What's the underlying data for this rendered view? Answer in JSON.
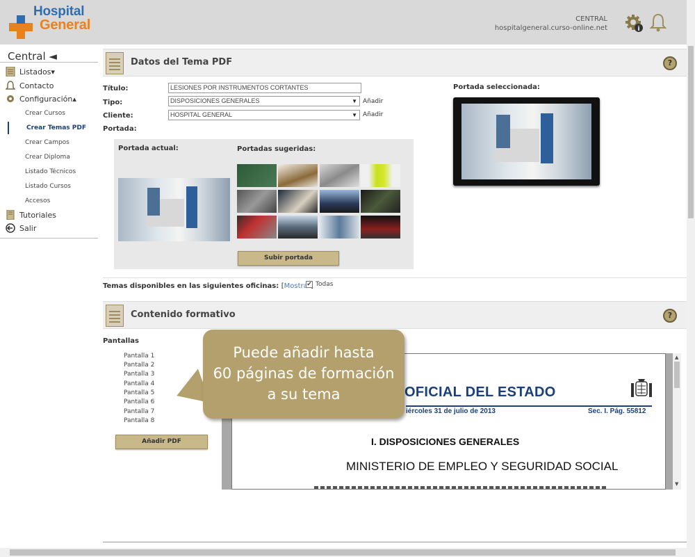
{
  "header": {
    "logo_line1": "Hospital",
    "logo_line2": "General",
    "account_name": "CENTRAL",
    "account_domain": "hospitalgeneral.curso-online.net",
    "settings_icon": "gear-info-icon",
    "notifications_icon": "bell-icon"
  },
  "sidebar": {
    "title": "Central ◄",
    "items": [
      {
        "label": "Listados▾",
        "icon": "list-icon"
      },
      {
        "label": "Contacto",
        "icon": "bell-icon"
      },
      {
        "label": "Configuración▴",
        "icon": "gear-icon"
      },
      {
        "label": "Tutoriales",
        "icon": "book-icon"
      },
      {
        "label": "Salir",
        "icon": "exit-icon"
      }
    ],
    "subitems": [
      "Crear Cursos",
      "Crear Temas PDF",
      "Crear Campos",
      "Crear Diploma",
      "Listado Técnicos",
      "Listado Cursos",
      "Accesos"
    ],
    "active_subitem": "Crear Temas PDF"
  },
  "section1": {
    "title": "Datos del Tema PDF",
    "help": "?",
    "titulo_label": "Título:",
    "titulo_value": "LESIONES POR INSTRUMENTOS CORTANTES",
    "tipo_label": "Tipo:",
    "tipo_value": "DISPOSICIONES GENERALES",
    "cliente_label": "Cliente:",
    "cliente_value": "HOSPITAL GENERAL",
    "add_label": "Añadir",
    "portada_label": "Portada:",
    "portada_actual": "Portada actual:",
    "portadas_sugeridas": "Portadas sugeridas:",
    "upload_button": "Subir portada",
    "portada_seleccionada": "Portada seleccionada:"
  },
  "offices": {
    "label": "Temas disponibles en las siguientes oficinas:",
    "show_link": "Mostrar",
    "bracket_open": "[",
    "bracket_close": "]",
    "all_label": "Todas",
    "all_checked": true
  },
  "section2": {
    "title": "Contenido formativo",
    "help": "?",
    "pantallas_label": "Pantallas",
    "pantallas": [
      "Pantalla 1",
      "Pantalla 2",
      "Pantalla 3",
      "Pantalla 4",
      "Pantalla 5",
      "Pantalla 6",
      "Pantalla 7",
      "Pantalla 8"
    ],
    "add_pdf_button": "Añadir PDF"
  },
  "pdf": {
    "heading": "OFICIAL DEL ESTADO",
    "date": "iércoles 31 de julio de 2013",
    "section": "Sec. I.   Pág. 55812",
    "disposiciones": "I.   DISPOSICIONES GENERALES",
    "ministry": "MINISTERIO DE EMPLEO Y SEGURIDAD SOCIAL"
  },
  "callout": {
    "line1": "Puede añadir hasta",
    "line2": "60 páginas de formación",
    "line3": "a su tema"
  },
  "colors": {
    "accent": "#b3a06c",
    "logo_blue": "#2f6db0",
    "logo_orange": "#e8821e",
    "active_nav": "#1a3f7a"
  }
}
